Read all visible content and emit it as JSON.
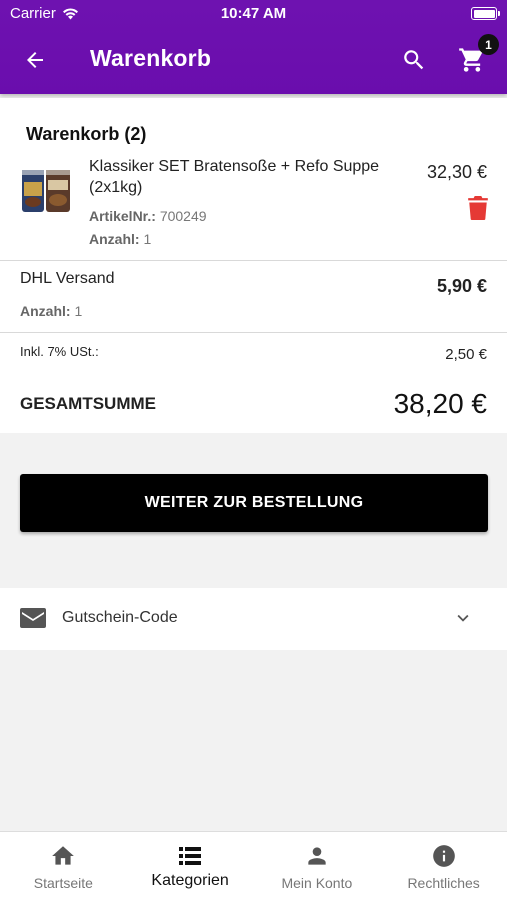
{
  "status_bar": {
    "carrier": "Carrier",
    "time": "10:47 AM"
  },
  "header": {
    "title": "Warenkorb",
    "cart_count": "1"
  },
  "cart": {
    "heading": "Warenkorb (2)",
    "item": {
      "name": "Klassiker SET Bratensoße + Refo Suppe (2x1kg)",
      "price": "32,30 €",
      "article_label": "ArtikelNr.:",
      "article_no": "700249",
      "qty_label": "Anzahl:",
      "qty": "1"
    },
    "shipping": {
      "name": "DHL Versand",
      "price": "5,90 €",
      "qty_label": "Anzahl:",
      "qty": "1"
    },
    "vat": {
      "label": "Inkl. 7% USt.:",
      "value": "2,50 €"
    },
    "total": {
      "label": "GESAMTSUMME",
      "value": "38,20 €"
    }
  },
  "checkout_button": "WEITER ZUR BESTELLUNG",
  "voucher": {
    "label": "Gutschein-Code",
    "icon": "mail-icon"
  },
  "bottom_nav": [
    {
      "label": "Startseite",
      "icon": "home-icon",
      "active": false
    },
    {
      "label": "Kategorien",
      "icon": "list-icon",
      "active": true
    },
    {
      "label": "Mein Konto",
      "icon": "person-icon",
      "active": false
    },
    {
      "label": "Rechtliches",
      "icon": "info-icon",
      "active": false
    }
  ],
  "colors": {
    "app_bar": "#6a0dad",
    "delete": "#e53935",
    "button": "#000000"
  }
}
